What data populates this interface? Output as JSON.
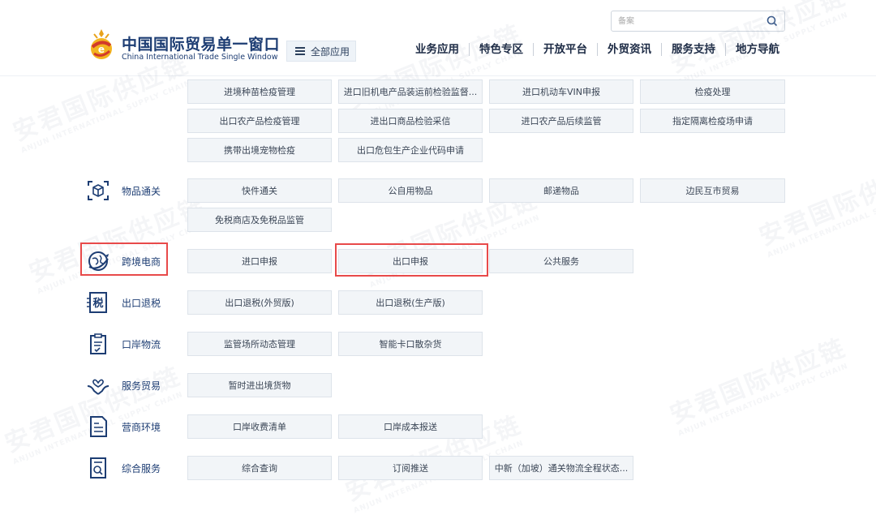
{
  "header": {
    "brand_cn": "中国国际贸易单一窗口",
    "brand_en": "China International Trade Single Window",
    "all_apps_label": "全部应用",
    "search_placeholder": "备案",
    "nav": [
      "业务应用",
      "特色专区",
      "开放平台",
      "外贸资讯",
      "服务支持",
      "地方导航"
    ]
  },
  "top_rows": [
    [
      "进境种苗检疫管理",
      "进口旧机电产品装运前检验监督...",
      "进口机动车VIN申报",
      "检疫处理"
    ],
    [
      "出口农产品检疫管理",
      "进出口商品检验采信",
      "进口农产品后续监管",
      "指定隔离检疫场申请"
    ],
    [
      "携带出境宠物检疫",
      "出口危包生产企业代码申请"
    ]
  ],
  "categories": [
    {
      "label": "物品通关",
      "icon": "package-scan-icon",
      "rows": [
        [
          "快件通关",
          "公自用物品",
          "邮递物品",
          "边民互市贸易"
        ],
        [
          "免税商店及免税品监管"
        ]
      ]
    },
    {
      "label": "跨境电商",
      "icon": "globe-plane-icon",
      "rows": [
        [
          "进口申报",
          "出口申报",
          "公共服务"
        ]
      ]
    },
    {
      "label": "出口退税",
      "icon": "tax-icon",
      "icon_text": "税",
      "rows": [
        [
          "出口退税(外贸版)",
          "出口退税(生产版)"
        ]
      ]
    },
    {
      "label": "口岸物流",
      "icon": "clipboard-icon",
      "rows": [
        [
          "监管场所动态管理",
          "智能卡口散杂货"
        ]
      ]
    },
    {
      "label": "服务贸易",
      "icon": "hands-heart-icon",
      "rows": [
        [
          "暂时进出境货物"
        ]
      ]
    },
    {
      "label": "营商环境",
      "icon": "document-icon",
      "rows": [
        [
          "口岸收费清单",
          "口岸成本报送"
        ]
      ]
    },
    {
      "label": "综合服务",
      "icon": "search-doc-icon",
      "rows": [
        [
          "综合查询",
          "订阅推送",
          "中新（加坡）通关物流全程状态..."
        ]
      ]
    }
  ],
  "watermark": {
    "cn": "安君国际供应链",
    "en": "ANJUN INTERNATIONAL SUPPLY CHAIN"
  },
  "colors": {
    "highlight": "#e84a4a",
    "brand": "#1d3d73",
    "button_bg": "#f2f5f8"
  }
}
